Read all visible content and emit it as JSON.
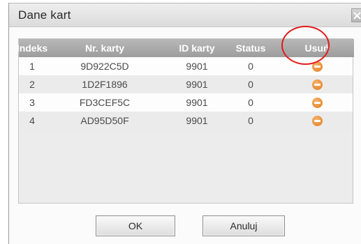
{
  "dialog": {
    "title": "Dane kart",
    "close_glyph": "×"
  },
  "table": {
    "headers": [
      "Indeks",
      "Nr. karty",
      "ID karty",
      "Status",
      "Usuń"
    ],
    "rows": [
      {
        "index": "1",
        "card_no": "9D922C5D",
        "card_id": "9901",
        "status": "0",
        "delete_icon": "remove-icon"
      },
      {
        "index": "2",
        "card_no": "1D2F1896",
        "card_id": "9901",
        "status": "0",
        "delete_icon": "remove-icon"
      },
      {
        "index": "3",
        "card_no": "FD3CEF5C",
        "card_id": "9901",
        "status": "0",
        "delete_icon": "remove-icon"
      },
      {
        "index": "4",
        "card_no": "AD95D50F",
        "card_id": "9901",
        "status": "0",
        "delete_icon": "remove-icon"
      }
    ]
  },
  "buttons": {
    "ok": "OK",
    "cancel": "Anuluj"
  },
  "colors": {
    "header_bg": "#a8a8a8",
    "remove_icon": "#e88a2e",
    "highlight_circle": "#e21b1b"
  }
}
